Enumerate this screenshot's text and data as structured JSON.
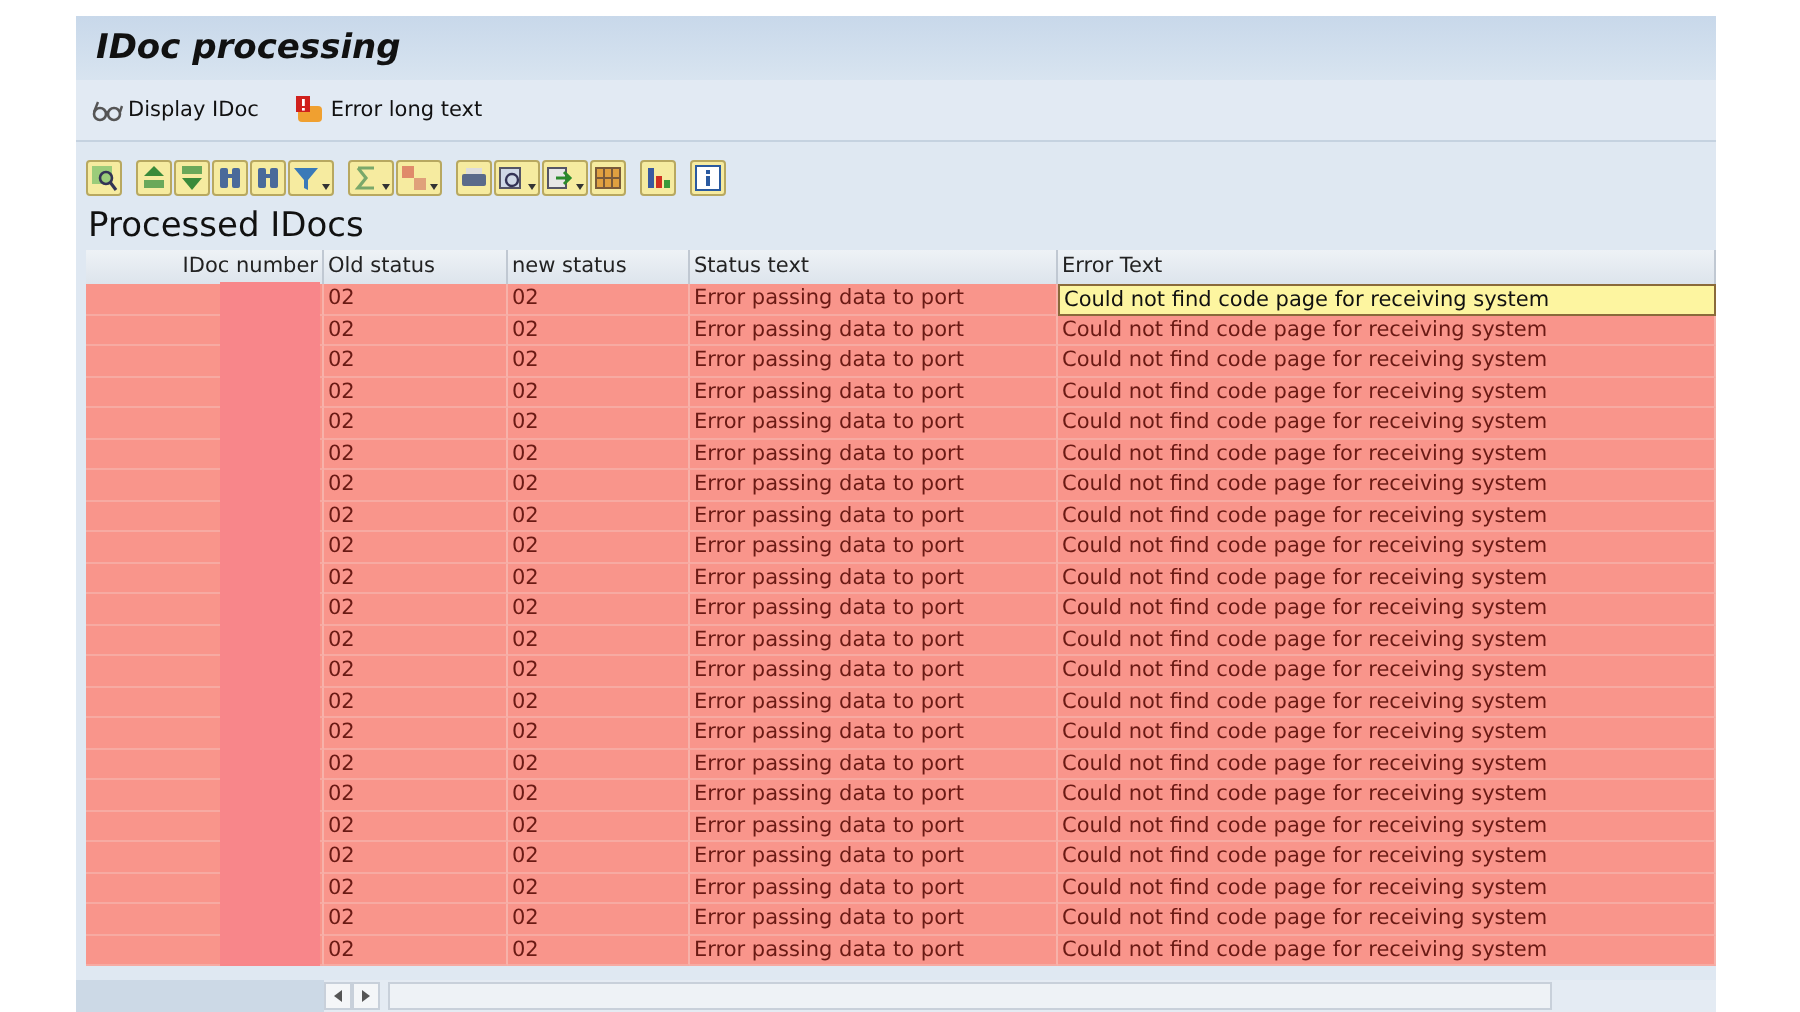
{
  "window": {
    "title": "IDoc processing"
  },
  "actions": [
    {
      "label": "Display IDoc",
      "kind": "glasses"
    },
    {
      "label": "Error long text",
      "kind": "error"
    }
  ],
  "section_title": "Processed IDocs",
  "table": {
    "columns": [
      "IDoc number",
      "Old status",
      "new status",
      "Status text",
      "Error Text"
    ],
    "rows": [
      {
        "old_status": "02",
        "new_status": "02",
        "status_text": "Error passing data to port",
        "error_text": "Could not find code page for receiving system",
        "selected": true,
        "redacted": true
      },
      {
        "old_status": "02",
        "new_status": "02",
        "status_text": "Error passing data to port",
        "error_text": "Could not find code page for receiving system",
        "selected": false,
        "redacted": true
      },
      {
        "old_status": "02",
        "new_status": "02",
        "status_text": "Error passing data to port",
        "error_text": "Could not find code page for receiving system",
        "selected": false,
        "redacted": true
      },
      {
        "old_status": "02",
        "new_status": "02",
        "status_text": "Error passing data to port",
        "error_text": "Could not find code page for receiving system",
        "selected": false,
        "redacted": true
      },
      {
        "old_status": "02",
        "new_status": "02",
        "status_text": "Error passing data to port",
        "error_text": "Could not find code page for receiving system",
        "selected": false,
        "redacted": true
      },
      {
        "old_status": "02",
        "new_status": "02",
        "status_text": "Error passing data to port",
        "error_text": "Could not find code page for receiving system",
        "selected": false,
        "redacted": true
      },
      {
        "old_status": "02",
        "new_status": "02",
        "status_text": "Error passing data to port",
        "error_text": "Could not find code page for receiving system",
        "selected": false,
        "redacted": true
      },
      {
        "old_status": "02",
        "new_status": "02",
        "status_text": "Error passing data to port",
        "error_text": "Could not find code page for receiving system",
        "selected": false,
        "redacted": true
      },
      {
        "old_status": "02",
        "new_status": "02",
        "status_text": "Error passing data to port",
        "error_text": "Could not find code page for receiving system",
        "selected": false,
        "redacted": true
      },
      {
        "old_status": "02",
        "new_status": "02",
        "status_text": "Error passing data to port",
        "error_text": "Could not find code page for receiving system",
        "selected": false,
        "redacted": true
      },
      {
        "old_status": "02",
        "new_status": "02",
        "status_text": "Error passing data to port",
        "error_text": "Could not find code page for receiving system",
        "selected": false,
        "redacted": true
      },
      {
        "old_status": "02",
        "new_status": "02",
        "status_text": "Error passing data to port",
        "error_text": "Could not find code page for receiving system",
        "selected": false,
        "redacted": true
      },
      {
        "old_status": "02",
        "new_status": "02",
        "status_text": "Error passing data to port",
        "error_text": "Could not find code page for receiving system",
        "selected": false,
        "redacted": true
      },
      {
        "old_status": "02",
        "new_status": "02",
        "status_text": "Error passing data to port",
        "error_text": "Could not find code page for receiving system",
        "selected": false,
        "redacted": true
      },
      {
        "old_status": "02",
        "new_status": "02",
        "status_text": "Error passing data to port",
        "error_text": "Could not find code page for receiving system",
        "selected": false,
        "redacted": true
      },
      {
        "old_status": "02",
        "new_status": "02",
        "status_text": "Error passing data to port",
        "error_text": "Could not find code page for receiving system",
        "selected": false,
        "redacted": true
      },
      {
        "old_status": "02",
        "new_status": "02",
        "status_text": "Error passing data to port",
        "error_text": "Could not find code page for receiving system",
        "selected": false,
        "redacted": true
      },
      {
        "old_status": "02",
        "new_status": "02",
        "status_text": "Error passing data to port",
        "error_text": "Could not find code page for receiving system",
        "selected": false,
        "redacted": true
      },
      {
        "old_status": "02",
        "new_status": "02",
        "status_text": "Error passing data to port",
        "error_text": "Could not find code page for receiving system",
        "selected": false,
        "redacted": true
      },
      {
        "old_status": "02",
        "new_status": "02",
        "status_text": "Error passing data to port",
        "error_text": "Could not find code page for receiving system",
        "selected": false,
        "redacted": true
      },
      {
        "old_status": "02",
        "new_status": "02",
        "status_text": "Error passing data to port",
        "error_text": "Could not find code page for receiving system",
        "selected": false,
        "redacted": true
      },
      {
        "old_status": "02",
        "new_status": "02",
        "status_text": "Error passing data to port",
        "error_text": "Could not find code page for receiving system",
        "selected": false,
        "redacted": true
      }
    ]
  }
}
